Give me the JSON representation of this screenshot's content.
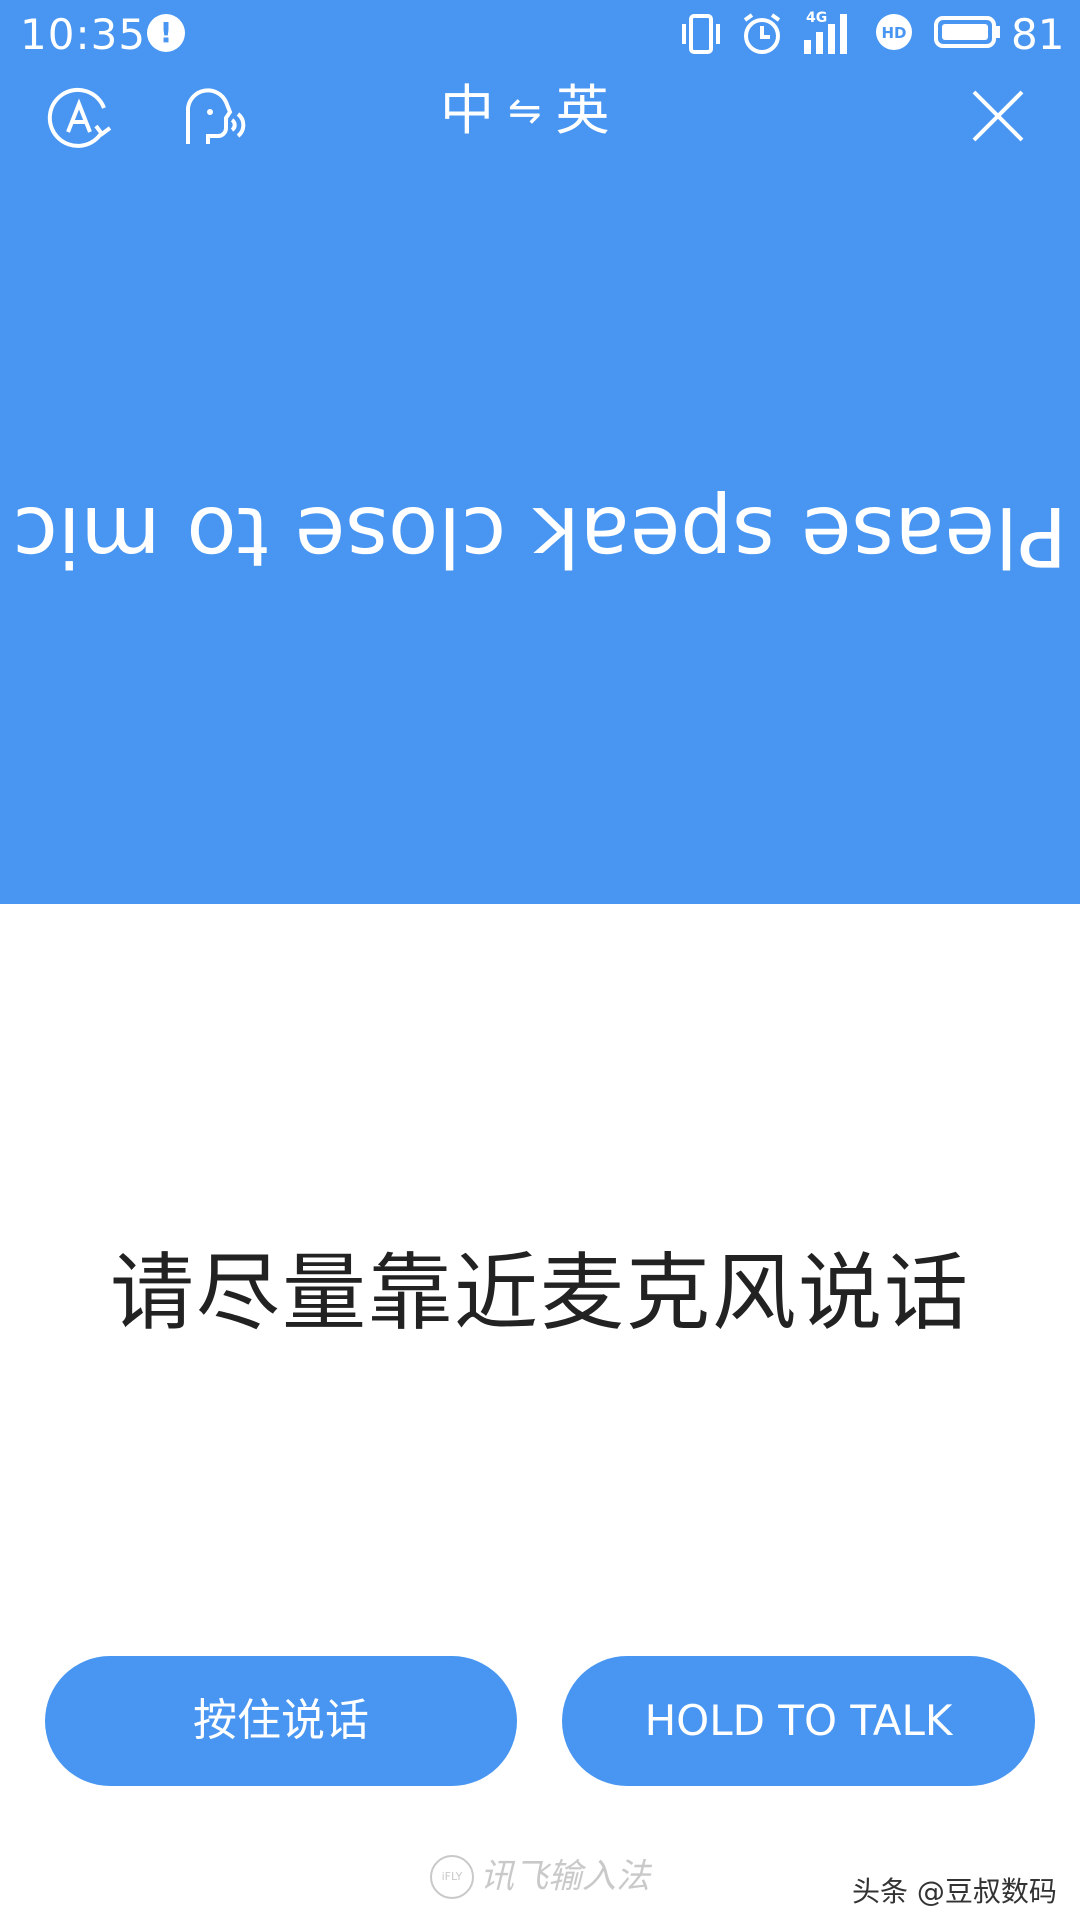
{
  "status_bar": {
    "time": "10:35",
    "network_label": "4G",
    "battery": "81"
  },
  "toolbar": {
    "lang_from": "中",
    "lang_arrow": "⇋",
    "lang_to": "英"
  },
  "prompt": {
    "english": "Please speak close to mic",
    "chinese": "请尽量靠近麦克风说话"
  },
  "buttons": {
    "hold_zh": "按住说话",
    "hold_en": "HOLD TO TALK"
  },
  "watermark": {
    "logo": "iFLY",
    "text": "讯飞输入法"
  },
  "credit": "头条 @豆叔数码",
  "colors": {
    "accent": "#4896f2",
    "text_dark": "#222222",
    "background": "#ffffff"
  }
}
